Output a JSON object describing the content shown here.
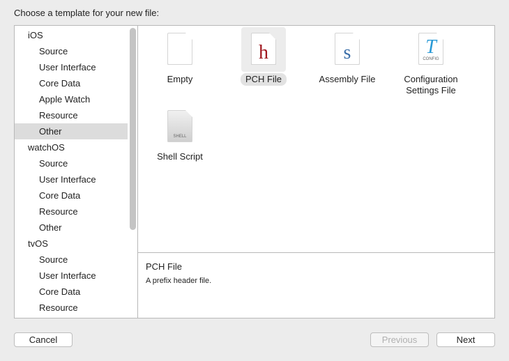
{
  "title": "Choose a template for your new file:",
  "sidebar": {
    "items": [
      {
        "label": "iOS",
        "type": "group"
      },
      {
        "label": "Source",
        "type": "sub"
      },
      {
        "label": "User Interface",
        "type": "sub"
      },
      {
        "label": "Core Data",
        "type": "sub"
      },
      {
        "label": "Apple Watch",
        "type": "sub"
      },
      {
        "label": "Resource",
        "type": "sub"
      },
      {
        "label": "Other",
        "type": "sub",
        "selected": true
      },
      {
        "label": "watchOS",
        "type": "group"
      },
      {
        "label": "Source",
        "type": "sub"
      },
      {
        "label": "User Interface",
        "type": "sub"
      },
      {
        "label": "Core Data",
        "type": "sub"
      },
      {
        "label": "Resource",
        "type": "sub"
      },
      {
        "label": "Other",
        "type": "sub"
      },
      {
        "label": "tvOS",
        "type": "group"
      },
      {
        "label": "Source",
        "type": "sub"
      },
      {
        "label": "User Interface",
        "type": "sub"
      },
      {
        "label": "Core Data",
        "type": "sub"
      },
      {
        "label": "Resource",
        "type": "sub"
      }
    ]
  },
  "templates": [
    {
      "label": "Empty",
      "icon": "empty-file-icon",
      "glyph": ""
    },
    {
      "label": "PCH File",
      "icon": "pch-file-icon",
      "glyph": "h",
      "color": "#a0171f",
      "selected": true
    },
    {
      "label": "Assembly File",
      "icon": "assembly-file-icon",
      "glyph": "s",
      "color": "#3a6ea8"
    },
    {
      "label": "Configuration Settings File",
      "icon": "config-file-icon",
      "glyph": "T",
      "color": "#2a9ad6",
      "badge": "CONFIG"
    },
    {
      "label": "Shell Script",
      "icon": "shell-script-icon",
      "glyph": "",
      "badge": "SHELL"
    }
  ],
  "description": {
    "title": "PCH File",
    "text": "A prefix header file."
  },
  "buttons": {
    "cancel": "Cancel",
    "previous": "Previous",
    "next": "Next"
  }
}
